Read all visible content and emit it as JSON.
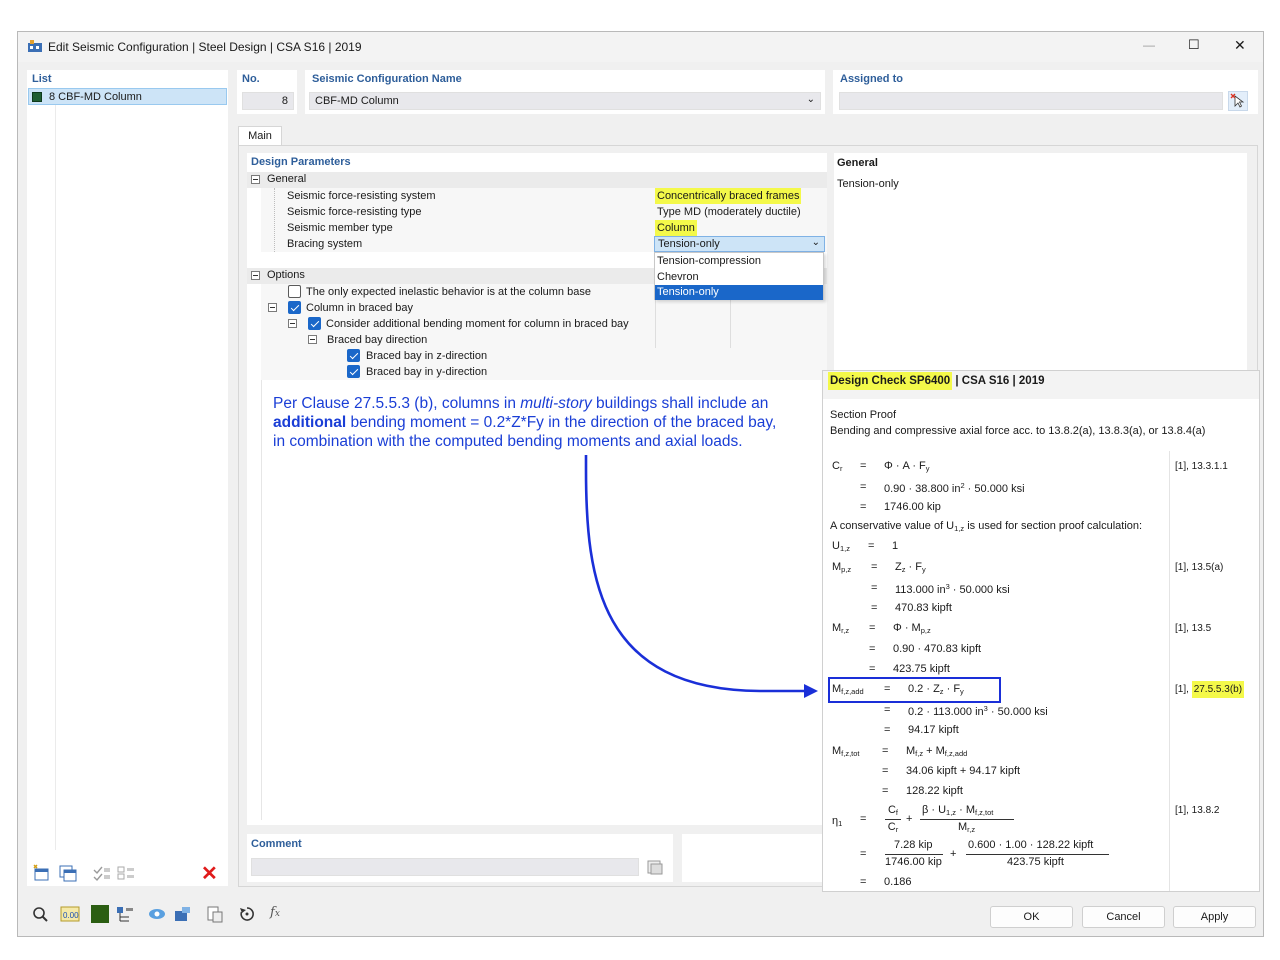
{
  "window": {
    "title": "Edit Seismic Configuration | Steel Design | CSA S16 | 2019",
    "minimize": "—",
    "maximize": "☐",
    "close": "✕"
  },
  "list": {
    "header": "List",
    "items": [
      {
        "label": "8 CBF-MD Column",
        "color": "#1f5e32"
      }
    ]
  },
  "header_fields": {
    "no_label": "No.",
    "no_value": "8",
    "name_label": "Seismic Configuration Name",
    "name_value": "CBF-MD Column",
    "assigned_label": "Assigned to",
    "assigned_value": ""
  },
  "tabs": [
    "Main"
  ],
  "design_params": {
    "header": "Design Parameters",
    "general_label": "General",
    "rows": [
      {
        "label": "Seismic force-resisting system",
        "value": "Concentrically braced frames"
      },
      {
        "label": "Seismic force-resisting type",
        "value": "Type MD (moderately ductile)"
      },
      {
        "label": "Seismic member type",
        "value": "Column"
      },
      {
        "label": "Bracing system",
        "value": "Tension-only"
      }
    ],
    "dropdown_options": [
      "Tension-compression",
      "Chevron",
      "Tension-only"
    ],
    "options_label": "Options",
    "options": [
      {
        "label": "The only expected inelastic behavior is at the column base",
        "checked": false
      },
      {
        "label": "Column in braced bay",
        "checked": true
      },
      {
        "label": "Consider additional bending moment for column in braced bay",
        "checked": true
      },
      {
        "label": "Braced bay direction",
        "checked": null
      },
      {
        "label": "Braced bay in z-direction",
        "checked": true
      },
      {
        "label": "Braced bay in y-direction",
        "checked": true
      }
    ]
  },
  "info_panel": {
    "title": "General",
    "text": "Tension-only"
  },
  "annotation": {
    "line1_pre": "Per Clause 27.5.5.3 (b), columns in ",
    "line1_em": "multi-story",
    "line1_post": " buildings shall include an",
    "line2_bold": "additional",
    "line2_post": " bending moment = 0.2*Z*Fy in the direction of the braced bay,",
    "line3": "in combination with the computed bending moments and axial loads."
  },
  "comment": {
    "label": "Comment",
    "value": ""
  },
  "design_check": {
    "title_hl": "Design Check SP6400",
    "title_rest": " | CSA S16 | 2019",
    "section": "Section Proof",
    "description": "Bending and compressive axial force acc. to 13.8.2(a), 13.8.3(a), or 13.8.4(a)",
    "conservative_note": "A conservative value of U",
    "conservative_note_sub": "1,z",
    "conservative_note_end": " is used for section proof calculation:",
    "refs": {
      "cr": "[1], 13.3.1.1",
      "mpz": "[1], 13.5(a)",
      "mrz": "[1], 13.5",
      "madd_pre": "[1], ",
      "madd_hl": "27.5.5.3(b)",
      "eta": "[1], 13.8.2"
    },
    "cr": {
      "eq1": "Φ · A · F",
      "eq2": "0.90 · 38.800 in",
      "eq2b": " · 50.000 ksi",
      "res": "1746.00 kip"
    },
    "u1z": "1",
    "mpz": {
      "eq1": "Z",
      "eq2": "113.000 in",
      "eq2b": " · 50.000 ksi",
      "res": "470.83 kipft"
    },
    "mrz": {
      "eq2": "0.90 · 470.83 kipft",
      "res": "423.75 kipft"
    },
    "madd": {
      "eq1": "0.2 · Z",
      "eq2": "0.2 · 113.000 in",
      "eq2b": " · 50.000 ksi",
      "res": "94.17 kipft"
    },
    "mtot": {
      "eq2": "34.06 kipft + 94.17 kipft",
      "res": "128.22 kipft"
    },
    "eta": {
      "f2num": "β · U",
      "num1": "7.28 kip",
      "den1": "1746.00 kip",
      "num2": "0.600 · 1.00 · 128.22 kipft",
      "den2": "423.75 kipft",
      "res": "0.186"
    }
  },
  "buttons": {
    "ok": "OK",
    "cancel": "Cancel",
    "apply": "Apply"
  },
  "colors": {
    "accent_blue": "#1a3ed6",
    "highlight": "#f4f94a",
    "selection": "#1a67c9"
  }
}
